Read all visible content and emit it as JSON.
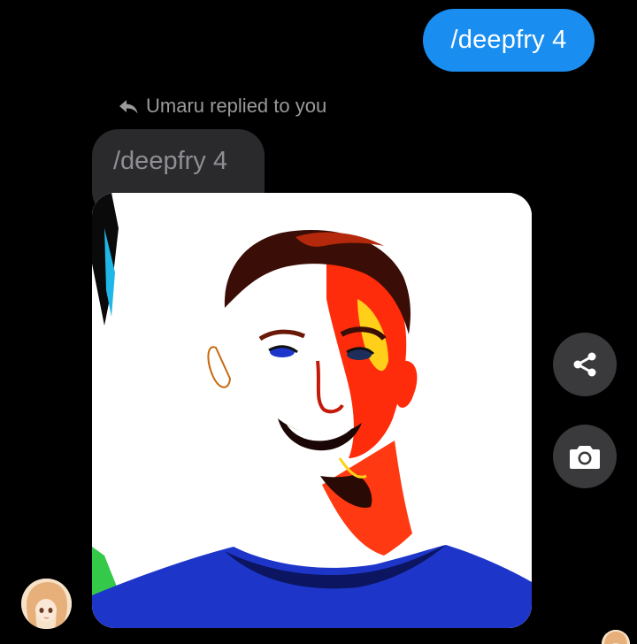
{
  "thread": {
    "outgoing_message": "/deepfry 4",
    "reply_header": "Umaru replied to you",
    "quoted_text": "/deepfry 4"
  },
  "actions": {
    "share_icon": "share-icon",
    "camera_icon": "camera-icon"
  },
  "colors": {
    "outgoing_bubble": "#1a8ef0",
    "quoted_bubble": "#2a2a2c",
    "action_button": "#3a3a3c",
    "background": "#000000"
  }
}
